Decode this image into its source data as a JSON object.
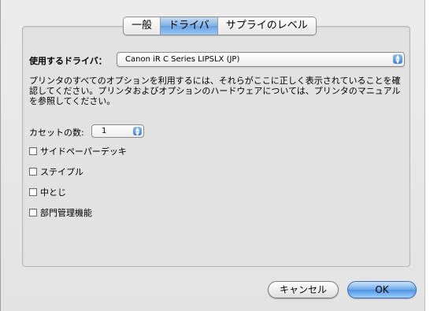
{
  "tabs": [
    {
      "label": "一般",
      "selected": false
    },
    {
      "label": "ドライバ",
      "selected": true
    },
    {
      "label": "サプライのレベル",
      "selected": false
    }
  ],
  "driver": {
    "label": "使用するドライバ：",
    "selected": "Canon iR C Series LIPSLX (JP)"
  },
  "description": {
    "line1": "プリンタのすべてのオプションを利用するには、それらがここに正しく表示されていることを確",
    "line2": "認してください。プリンタおよびオプションのハードウェアについては、プリンタのマニュアル",
    "line3": "を参照してください。"
  },
  "cassette": {
    "label": "カセットの数:",
    "value": "1"
  },
  "options": [
    {
      "label": "サイドペーパーデッキ",
      "checked": false
    },
    {
      "label": "ステイプル",
      "checked": false
    },
    {
      "label": "中とじ",
      "checked": false
    },
    {
      "label": "部門管理機能",
      "checked": false
    }
  ],
  "buttons": {
    "cancel": "キャンセル",
    "ok": "OK"
  },
  "colors": {
    "selected_tab": "#68a2e2",
    "default_button": "#4f93e0"
  }
}
